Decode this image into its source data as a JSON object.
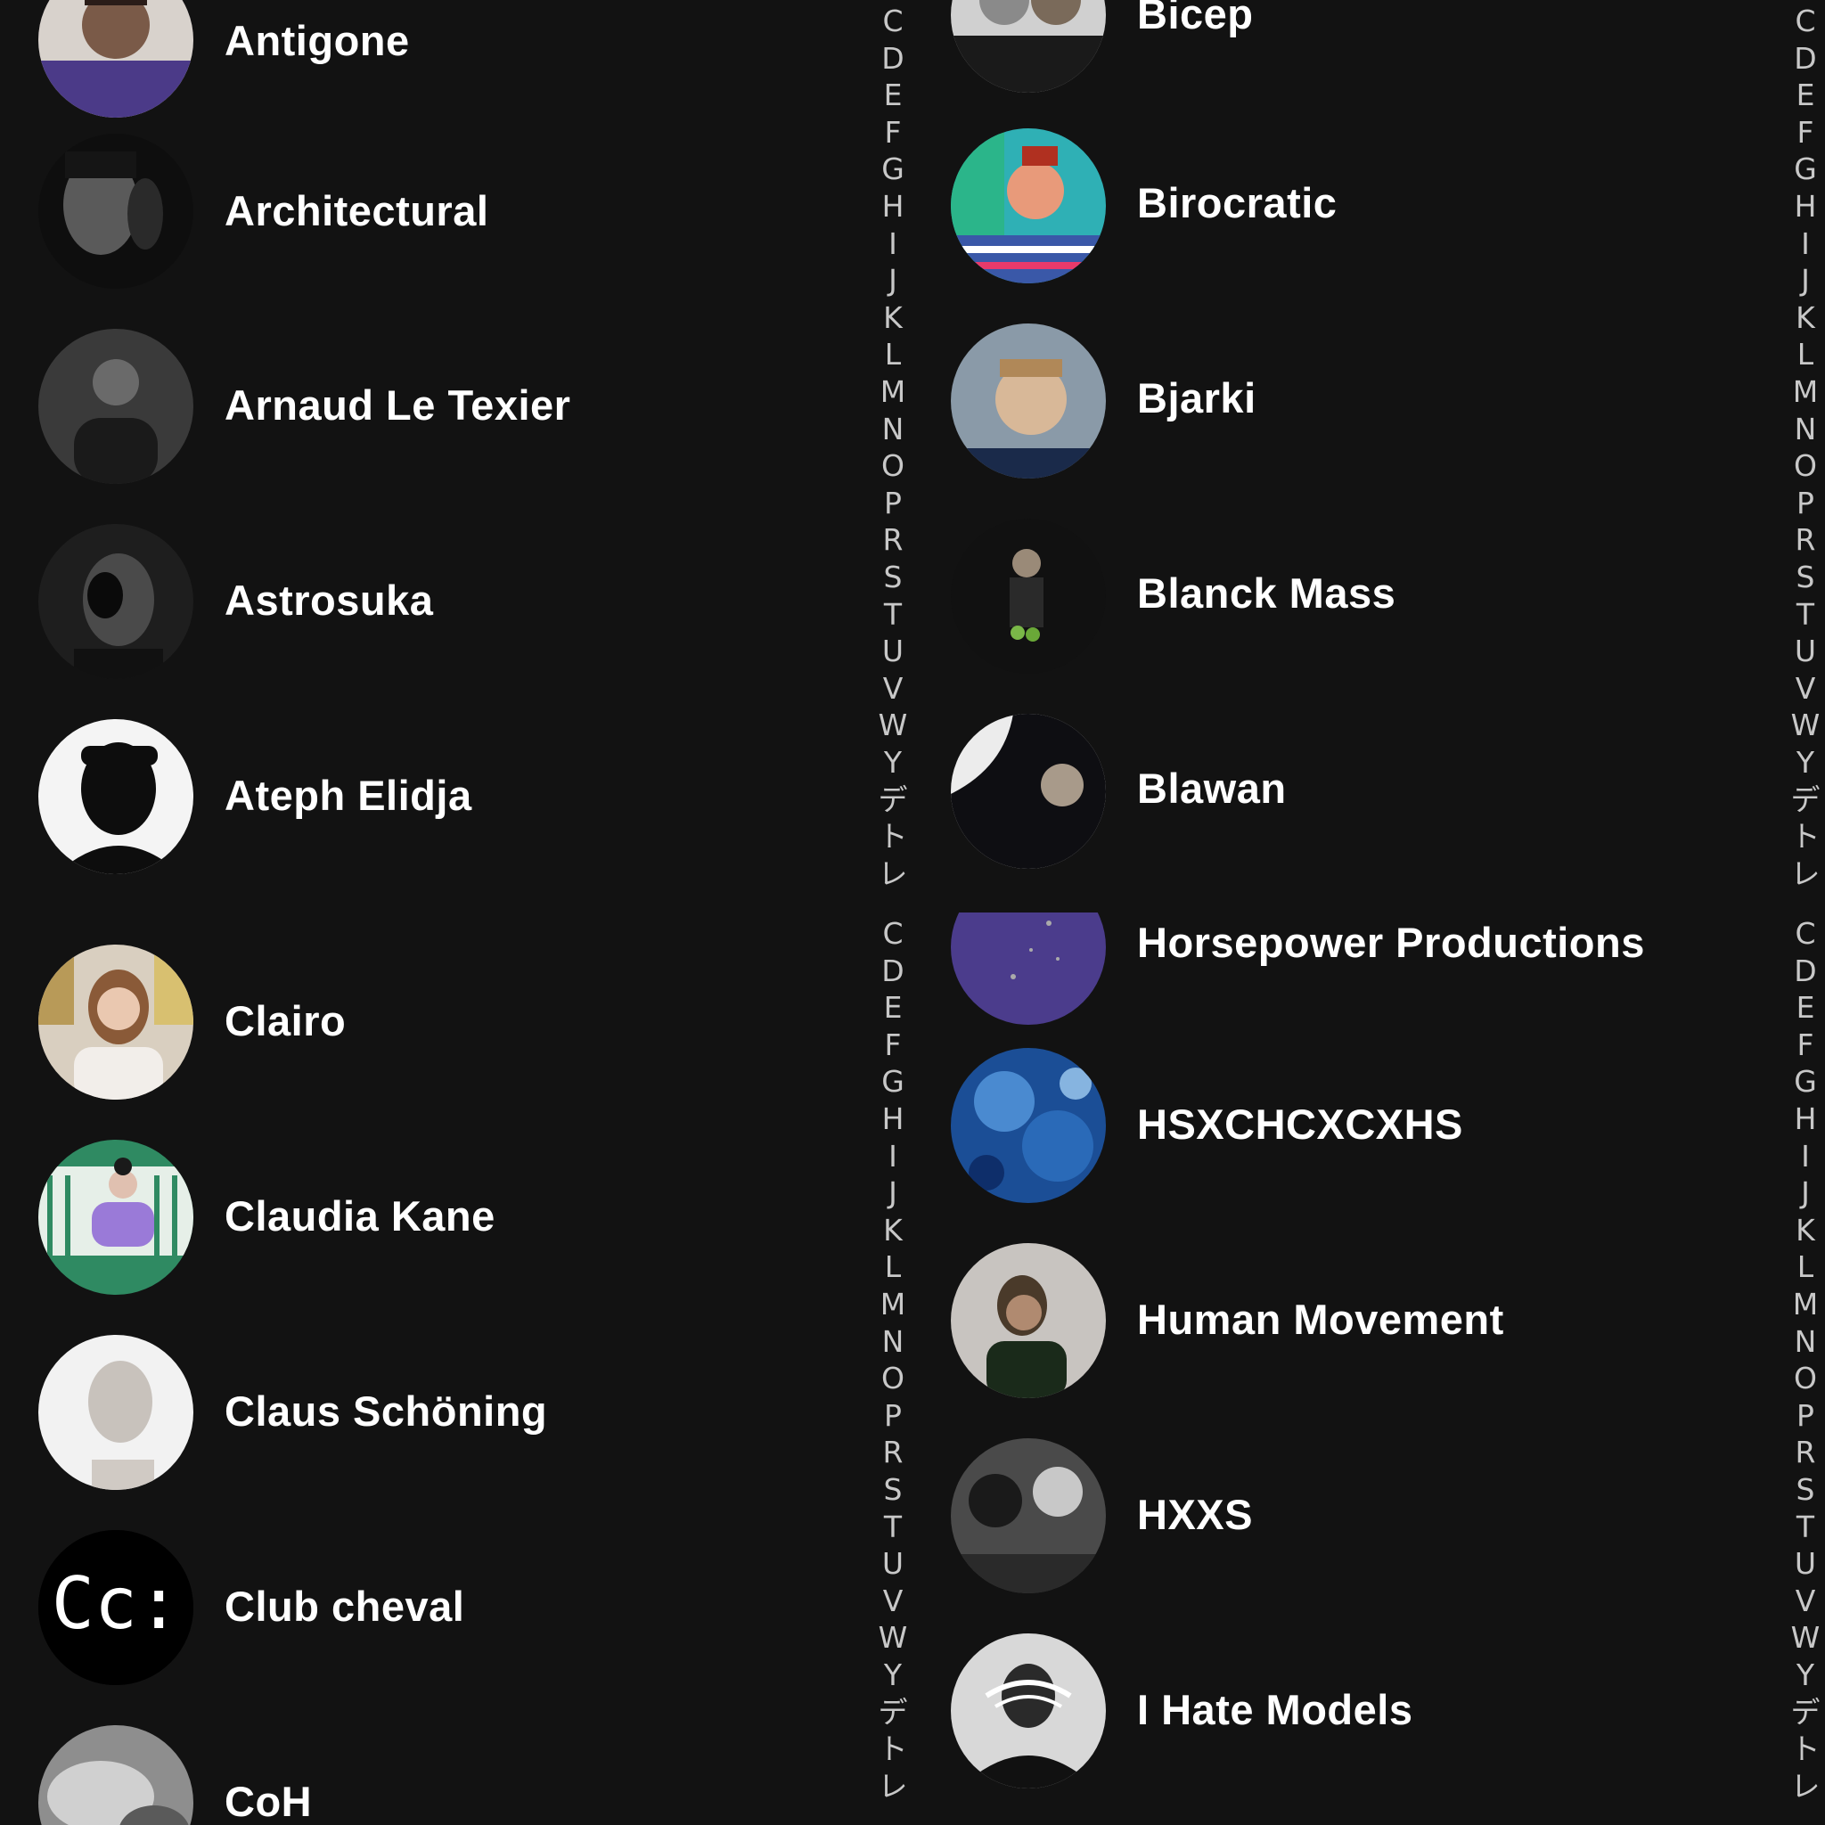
{
  "index_letters": [
    "C",
    "D",
    "E",
    "F",
    "G",
    "H",
    "I",
    "J",
    "K",
    "L",
    "M",
    "N",
    "O",
    "P",
    "R",
    "S",
    "T",
    "U",
    "V",
    "W",
    "Y",
    "デ",
    "ト",
    "レ"
  ],
  "pane_a": [
    {
      "name": "Antigone",
      "icon": "artist-avatar",
      "bg": "#5a5060"
    },
    {
      "name": "Architectural",
      "icon": "artist-avatar",
      "bg": "#1a1a1a"
    },
    {
      "name": "Arnaud Le Texier",
      "icon": "artist-avatar",
      "bg": "#2a2a2a"
    },
    {
      "name": "Astrosuka",
      "icon": "artist-avatar",
      "bg": "#222222"
    },
    {
      "name": "Ateph Elidja",
      "icon": "artist-avatar",
      "bg": "#f4f4f4"
    }
  ],
  "pane_b": [
    {
      "name": "Bicep",
      "icon": "artist-avatar",
      "bg": "#3a3a3a"
    },
    {
      "name": "Birocratic",
      "icon": "artist-avatar",
      "bg": "#3aaeb0"
    },
    {
      "name": "Bjarki",
      "icon": "artist-avatar",
      "bg": "#4a5a6a"
    },
    {
      "name": "Blanck Mass",
      "icon": "artist-avatar",
      "bg": "#1c1c1c"
    },
    {
      "name": "Blawan",
      "icon": "artist-avatar",
      "bg": "#e8e8e8"
    }
  ],
  "pane_c": [
    {
      "name": "Clairo",
      "icon": "artist-avatar",
      "bg": "#c9b39a"
    },
    {
      "name": "Claudia Kane",
      "icon": "artist-avatar",
      "bg": "#3a8a6a"
    },
    {
      "name": "Claus Schöning",
      "icon": "artist-avatar",
      "bg": "#f0f0f0"
    },
    {
      "name": "Club cheval",
      "icon": "club-cheval-logo",
      "logo_text": "Cc:",
      "bg": "#000000"
    },
    {
      "name": "CoH",
      "icon": "artist-avatar",
      "bg": "#9a9a9a"
    }
  ],
  "pane_d": [
    {
      "name": "Horsepower Productions",
      "icon": "artist-avatar",
      "bg": "#4b3c8c"
    },
    {
      "name": "HSXCHCXCXHS",
      "icon": "artist-avatar",
      "bg": "#1e5aa0"
    },
    {
      "name": "Human Movement",
      "icon": "artist-avatar",
      "bg": "#c4c0bc"
    },
    {
      "name": "HXXS",
      "icon": "artist-avatar",
      "bg": "#555555"
    },
    {
      "name": "I Hate Models",
      "icon": "artist-avatar",
      "bg": "#1a1a1a"
    }
  ]
}
